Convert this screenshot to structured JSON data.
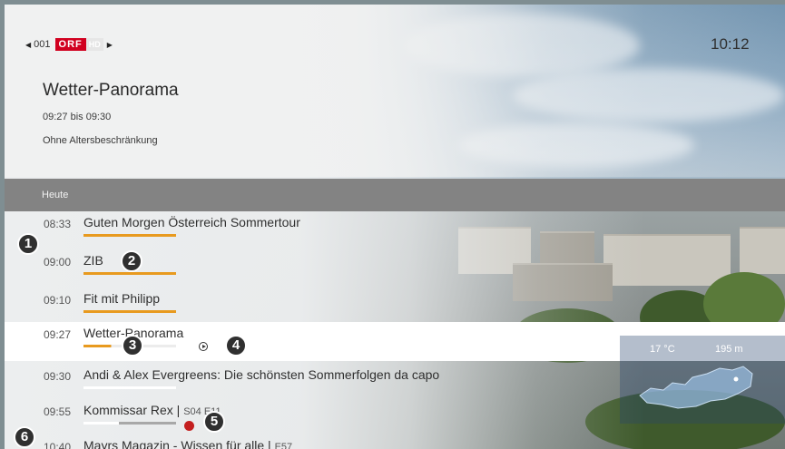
{
  "header": {
    "channel_number": "001",
    "channel_logo_main": "ORF",
    "channel_logo_suffix": "HD",
    "clock": "10:12"
  },
  "current_program": {
    "title": "Wetter-Panorama",
    "time_range": "09:27 bis 09:30",
    "age_rating": "Ohne Altersbeschränkung"
  },
  "day_label": "Heute",
  "programs": [
    {
      "time": "08:33",
      "name": "Guten Morgen Österreich Sommertour",
      "episode": "",
      "progress": 1.0
    },
    {
      "time": "09:00",
      "name": "ZIB",
      "episode": "",
      "progress": 1.0
    },
    {
      "time": "09:10",
      "name": "Fit mit Philipp",
      "episode": "",
      "progress": 1.0
    },
    {
      "time": "09:27",
      "name": "Wetter-Panorama",
      "episode": "",
      "progress": 0.3,
      "selected": true
    },
    {
      "time": "09:30",
      "name": "Andi & Alex Evergreens: Die schönsten Sommerfolgen da capo",
      "episode": "",
      "progress": 0
    },
    {
      "time": "09:55",
      "name": "Kommissar Rex",
      "episode": "S04 E11",
      "progress": 0,
      "recording": true
    },
    {
      "time": "10:40",
      "name": "Mayrs Magazin - Wissen für alle",
      "episode": "E57",
      "progress": 0
    }
  ],
  "callouts": [
    "1",
    "2",
    "3",
    "4",
    "5",
    "6"
  ],
  "weather": {
    "temperature": "17 °C",
    "altitude": "195 m"
  },
  "icons": {
    "left": "chevron-left-icon",
    "right": "chevron-right-icon",
    "play": "play-icon",
    "record": "record-dot-icon"
  },
  "colors": {
    "progress": "#e89a1f",
    "record": "#c41f1f",
    "logo": "#d1001f",
    "daybar": "#838383"
  }
}
